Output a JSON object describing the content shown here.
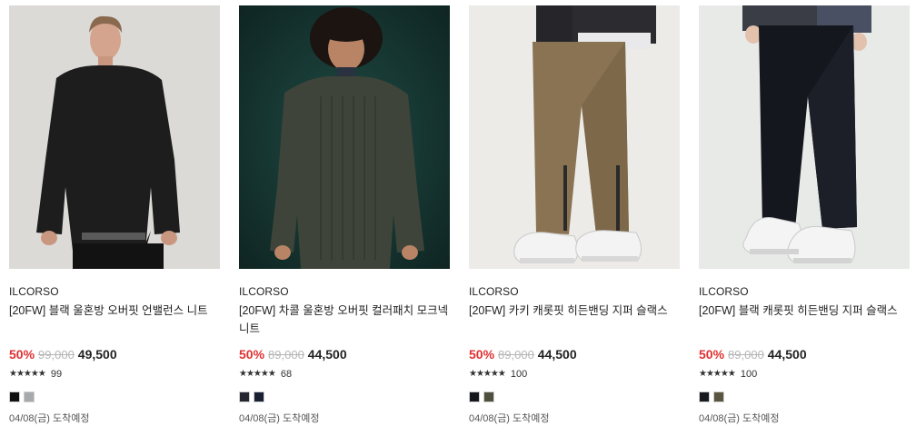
{
  "products": [
    {
      "brand": "ILCORSO",
      "name": "[20FW] 블랙 울혼방 오버핏 언밸런스 니트",
      "discount": "50%",
      "original_price": "99,000",
      "sale_price": "49,500",
      "stars": "★★★★★",
      "rating_value": 4.5,
      "review_count": "99",
      "swatches": [
        "#111111",
        "#a7a9ab"
      ],
      "delivery": "04/08(금) 도착예정"
    },
    {
      "brand": "ILCORSO",
      "name": "[20FW] 차콜 울혼방 오버핏 컬러패치 모크넥 니트",
      "discount": "50%",
      "original_price": "89,000",
      "sale_price": "44,500",
      "stars": "★★★★★",
      "rating_value": 4.8,
      "review_count": "68",
      "swatches": [
        "#23262e",
        "#1a2033"
      ],
      "delivery": "04/08(금) 도착예정"
    },
    {
      "brand": "ILCORSO",
      "name": "[20FW] 카키 캐롯핏 히든밴딩 지퍼 슬랙스",
      "discount": "50%",
      "original_price": "89,000",
      "sale_price": "44,500",
      "stars": "★★★★★",
      "rating_value": 4.5,
      "review_count": "100",
      "swatches": [
        "#15171c",
        "#4f4f3e"
      ],
      "delivery": "04/08(금) 도착예정"
    },
    {
      "brand": "ILCORSO",
      "name": "[20FW] 블랙 캐롯핏 히든밴딩 지퍼 슬랙스",
      "discount": "50%",
      "original_price": "89,000",
      "sale_price": "44,500",
      "stars": "★★★★★",
      "rating_value": 4.5,
      "review_count": "100",
      "swatches": [
        "#17191d",
        "#5a5540"
      ],
      "delivery": "04/08(금) 도착예정"
    }
  ]
}
